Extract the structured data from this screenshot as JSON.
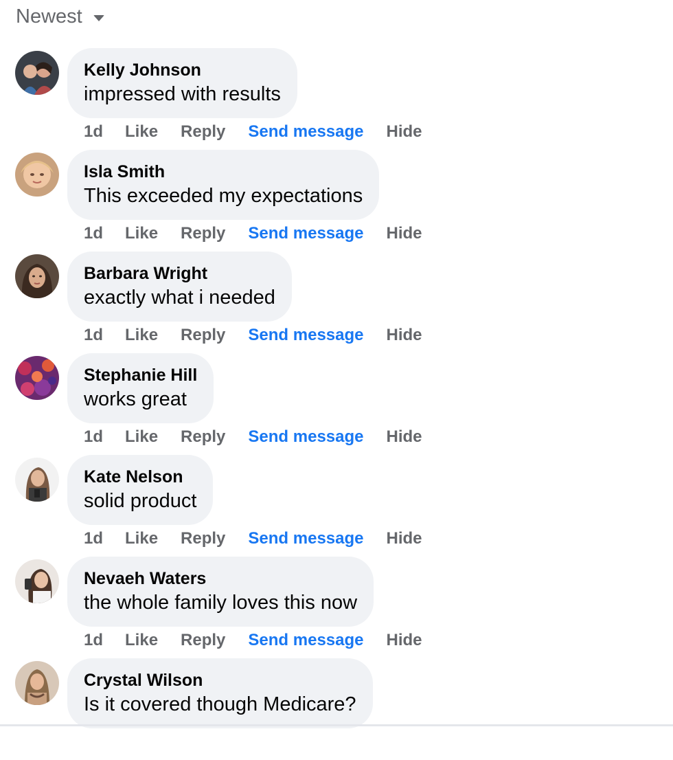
{
  "sort": {
    "label": "Newest",
    "icon": "caret-down-icon"
  },
  "colors": {
    "bubble_bg": "#f0f2f5",
    "meta_text": "#65676b",
    "link_blue": "#1877f2"
  },
  "comments": [
    {
      "author": "Kelly Johnson",
      "text": "impressed with results",
      "time": "1d",
      "like": "Like",
      "reply": "Reply",
      "send_message": "Send message",
      "hide": "Hide"
    },
    {
      "author": "Isla Smith",
      "text": "This exceeded my expectations",
      "time": "1d",
      "like": "Like",
      "reply": "Reply",
      "send_message": "Send message",
      "hide": "Hide"
    },
    {
      "author": "Barbara Wright",
      "text": "exactly what i needed",
      "time": "1d",
      "like": "Like",
      "reply": "Reply",
      "send_message": "Send message",
      "hide": "Hide"
    },
    {
      "author": "Stephanie Hill",
      "text": "works great",
      "time": "1d",
      "like": "Like",
      "reply": "Reply",
      "send_message": "Send message",
      "hide": "Hide"
    },
    {
      "author": "Kate Nelson",
      "text": "solid product",
      "time": "1d",
      "like": "Like",
      "reply": "Reply",
      "send_message": "Send message",
      "hide": "Hide"
    },
    {
      "author": "Nevaeh Waters",
      "text": "the whole family loves this now",
      "time": "1d",
      "like": "Like",
      "reply": "Reply",
      "send_message": "Send message",
      "hide": "Hide"
    },
    {
      "author": "Crystal Wilson",
      "text": "Is it covered though Medicare?",
      "time": "",
      "like": "",
      "reply": "",
      "send_message": "",
      "hide": ""
    }
  ]
}
